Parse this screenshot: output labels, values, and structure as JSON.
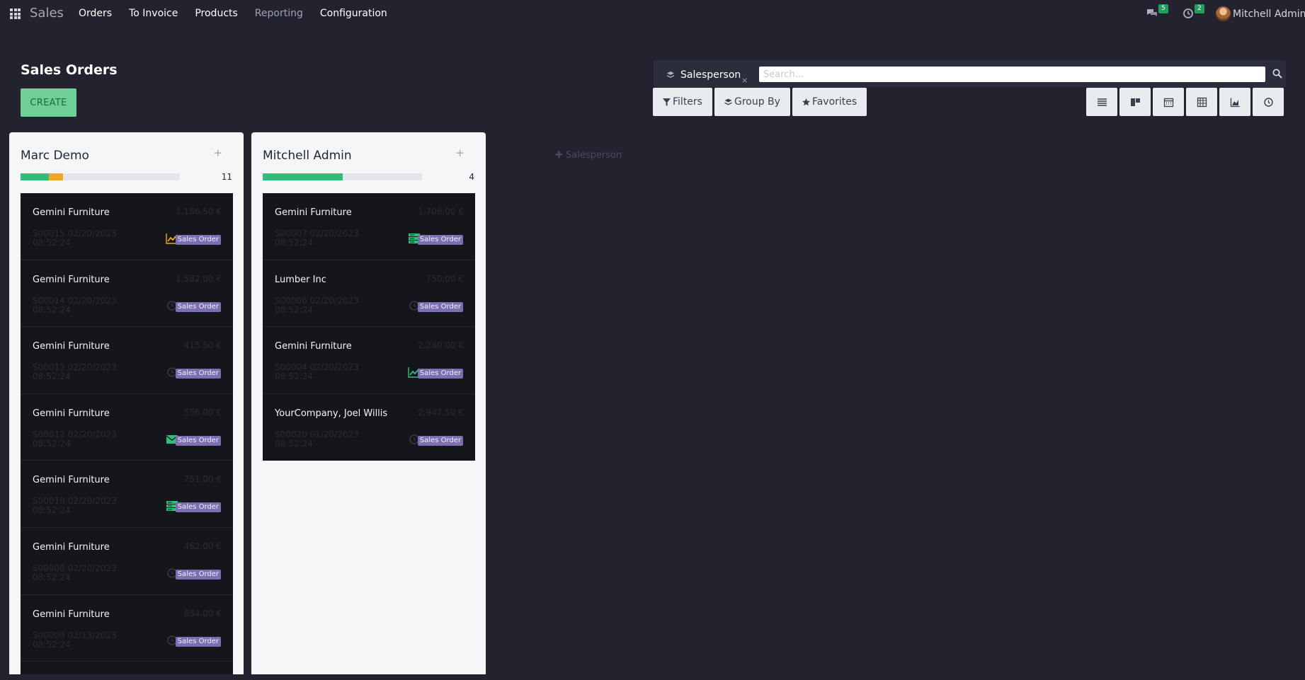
{
  "app": {
    "name": "Sales"
  },
  "menu": {
    "items": [
      "Orders",
      "To Invoice",
      "Products",
      "Reporting",
      "Configuration"
    ]
  },
  "systray": {
    "messages_count": "5",
    "activities_count": "2",
    "user_name": "Mitchell Admin"
  },
  "page": {
    "title": "Sales Orders",
    "create_label": "CREATE"
  },
  "search": {
    "facet_label": "Salesperson",
    "facet_remove": "×",
    "placeholder": "Search..."
  },
  "filters": {
    "filters_label": "Filters",
    "groupby_label": "Group By",
    "favorites_label": "Favorites"
  },
  "views": [
    "list-view-icon",
    "kanban-view-icon",
    "calendar-view-icon",
    "pivot-view-icon",
    "graph-view-icon",
    "activity-view-icon"
  ],
  "columns": [
    {
      "title": "Marc Demo",
      "add": "+",
      "count": "11",
      "progress": [
        {
          "fraction": 0.18,
          "color": "#2ec07b"
        },
        {
          "fraction": 0.09,
          "color": "#f0a824"
        }
      ],
      "cards": [
        {
          "partner": "Gemini Furniture",
          "amount": "1,186.50 €",
          "ref": "S00015 02/20/2023 08:52:24",
          "icon": "trend-icon",
          "tag": "Sales Order"
        },
        {
          "partner": "Gemini Furniture",
          "amount": "1,582.00 €",
          "ref": "S00014 02/20/2023 08:52:24",
          "icon": "clock-icon",
          "tag": "Sales Order"
        },
        {
          "partner": "Gemini Furniture",
          "amount": "415.50 €",
          "ref": "S00013 02/20/2023 08:52:24",
          "icon": "clock-icon",
          "tag": "Sales Order"
        },
        {
          "partner": "Gemini Furniture",
          "amount": "556.00 €",
          "ref": "S00012 02/20/2023 08:52:24",
          "icon": "email-icon",
          "tag": "Sales Order"
        },
        {
          "partner": "Gemini Furniture",
          "amount": "751.00 €",
          "ref": "S00010 02/20/2023 08:52:24",
          "icon": "server-icon",
          "tag": "Sales Order"
        },
        {
          "partner": "Gemini Furniture",
          "amount": "462.00 €",
          "ref": "S00008 02/20/2023 08:52:24",
          "icon": "clock-icon",
          "tag": "Sales Order"
        },
        {
          "partner": "Gemini Furniture",
          "amount": "654.00 €",
          "ref": "S00009 02/13/2023 08:52:24",
          "icon": "clock-icon",
          "tag": "Sales Order"
        }
      ]
    },
    {
      "title": "Mitchell Admin",
      "add": "+",
      "count": "4",
      "progress": [
        {
          "fraction": 0.5,
          "color": "#2ec07b"
        }
      ],
      "cards": [
        {
          "partner": "Gemini Furniture",
          "amount": "1,706.00 €",
          "ref": "S00007 02/20/2023 08:52:24",
          "icon": "server-icon",
          "tag": "Sales Order"
        },
        {
          "partner": "Lumber Inc",
          "amount": "750.00 €",
          "ref": "S00006 02/20/2023 08:52:24",
          "icon": "clock-icon",
          "tag": "Sales Order"
        },
        {
          "partner": "Gemini Furniture",
          "amount": "2,240.00 €",
          "ref": "S00004 02/20/2023 08:52:24",
          "icon": "trend-icon",
          "tag": "Sales Order"
        },
        {
          "partner": "YourCompany, Joel Willis",
          "amount": "2,947.50 €",
          "ref": "S00020 01/20/2023 08:52:24",
          "icon": "clock-icon",
          "tag": "Sales Order"
        }
      ]
    }
  ],
  "add_column": {
    "label": "✚ Salesperson"
  },
  "colors": {
    "background": "#22232f",
    "primary": "#6fcf97",
    "tag": "#7c6eb0",
    "success": "#2ec07b",
    "warning": "#f0a824"
  }
}
